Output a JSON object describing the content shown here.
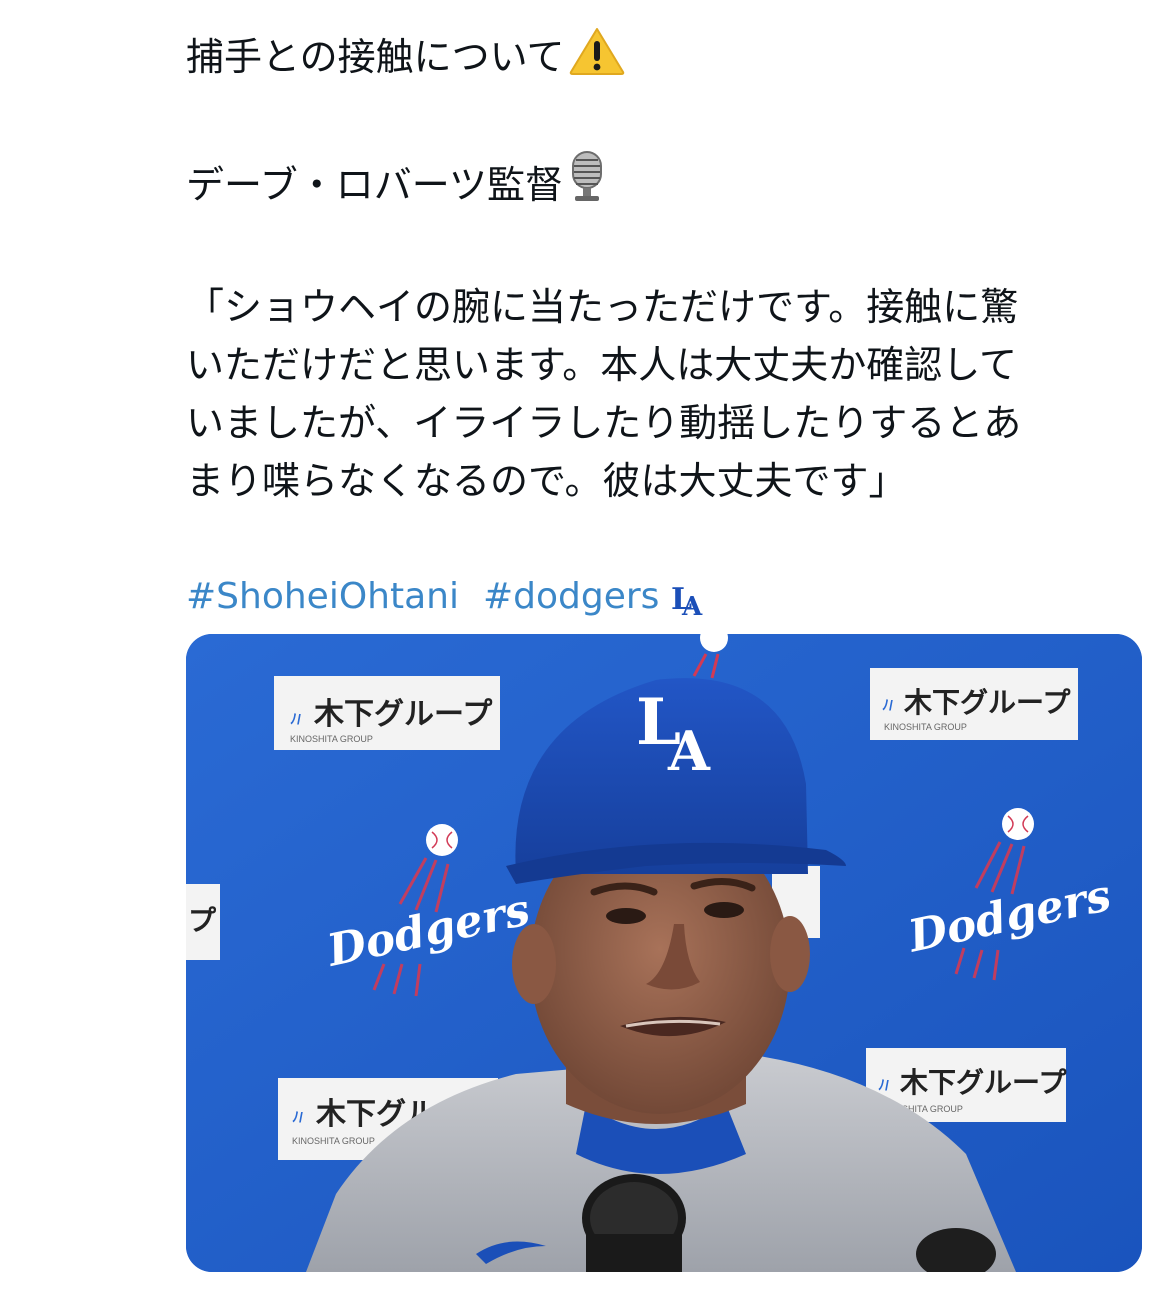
{
  "tweet": {
    "line1": "捕手との接触について",
    "line1_emoji": "warning-icon",
    "line2": "デーブ・ロバーツ監督",
    "line2_emoji": "microphone-icon",
    "quote": [
      "「ショウヘイの腕に当たっただけです。接触に驚",
      "いただけだと思います。本人は大丈夫か確認して",
      "いましたが、イライラしたり動揺したりするとあ",
      "まり喋らなくなるので。彼は大丈夫です」"
    ],
    "hashtags": [
      "#ShoheiOhtani",
      "#dodgers"
    ],
    "hashtag_emoji": "la-logo-icon"
  },
  "media": {
    "sponsor_text": "木下グループ",
    "sponsor_sub": "KINOSHITA GROUP",
    "team_script": "Dodgers",
    "cap_logo": "LA"
  },
  "colors": {
    "text": "#0f1419",
    "hashtag": "#3b87c8",
    "backdrop_blue": "#1f5fc9",
    "cap_blue": "#1b4fb8"
  }
}
